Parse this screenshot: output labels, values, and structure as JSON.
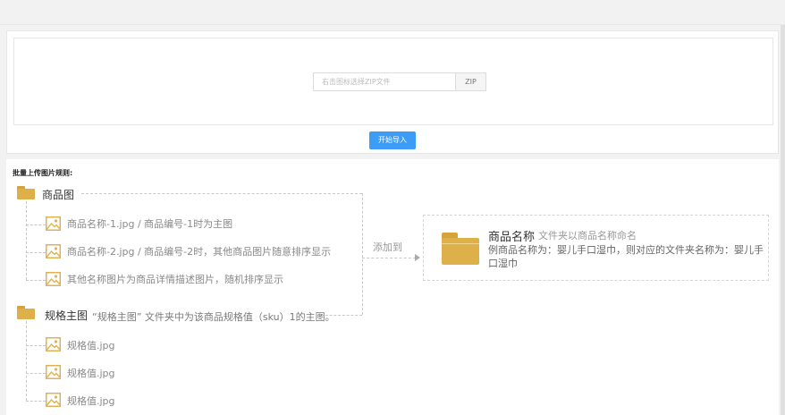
{
  "upload": {
    "placeholder": "右击图标选择ZIP文件",
    "zip_label": "ZIP",
    "start_label": "开始导入"
  },
  "rules": {
    "title": "批量上传图片规则:",
    "product_folder": {
      "label": "商品图",
      "items": [
        "商品名称-1.jpg  /  商品编号-1时为主图",
        "商品名称-2.jpg  /  商品编号-2时，其他商品图片随意排序显示",
        "其他名称图片为商品详情描述图片，随机排序显示"
      ]
    },
    "spec_folder": {
      "label": "规格主图",
      "note": "“规格主图” 文件夹中为该商品规格值（sku）1的主图。",
      "items": [
        "规格值.jpg",
        "规格值.jpg",
        "规格值.jpg"
      ]
    },
    "arrow_label": "添加到",
    "target": {
      "title": "商品名称",
      "subtitle": "文件夹以商品名称命名",
      "description": "例商品名称为：婴儿手口湿巾，则对应的文件夹名称为：婴儿手口湿巾"
    }
  },
  "colors": {
    "primary": "#3d9cf5",
    "folder": "#ddb04a"
  }
}
